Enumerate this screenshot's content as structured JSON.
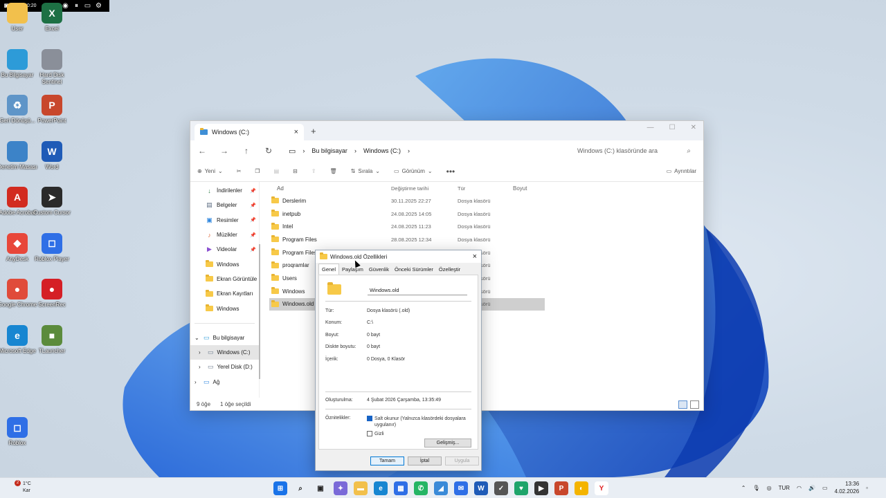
{
  "desktop": {
    "icons": [
      {
        "label": "User",
        "glyph": "",
        "color": "#f2c04c"
      },
      {
        "label": "Excel",
        "glyph": "X",
        "color": "#1d7044"
      },
      {
        "label": "Bu Bilgisayar",
        "glyph": "",
        "color": "#2d9bd8"
      },
      {
        "label": "Hard Disk Sentinel",
        "glyph": "",
        "color": "#8a8f99"
      },
      {
        "label": "Geri Dönüşü...",
        "glyph": "♻",
        "color": "#5f95c8"
      },
      {
        "label": "PowerPoint",
        "glyph": "P",
        "color": "#c8472c"
      },
      {
        "label": "Denetim Masası",
        "glyph": "",
        "color": "#3c83c8"
      },
      {
        "label": "Word",
        "glyph": "W",
        "color": "#1f5bb7"
      },
      {
        "label": "Adobe Acrobat",
        "glyph": "A",
        "color": "#d22b20"
      },
      {
        "label": "Custom Cursor",
        "glyph": "➤",
        "color": "#2a2a2a"
      },
      {
        "label": "AnyDesk",
        "glyph": "◆",
        "color": "#e8473a"
      },
      {
        "label": "Roblox Player",
        "glyph": "◻",
        "color": "#2f6fe6"
      },
      {
        "label": "Google Chrome",
        "glyph": "●",
        "color": "#e04b3a"
      },
      {
        "label": "ScreenRec",
        "glyph": "●",
        "color": "#d51f26"
      },
      {
        "label": "Microsoft Edge",
        "glyph": "e",
        "color": "#1786d1"
      },
      {
        "label": "TLauncher",
        "glyph": "■",
        "color": "#5b8b3c"
      },
      {
        "label": "Roblox",
        "glyph": "◻",
        "color": "#2f6fe6"
      }
    ]
  },
  "recbar": {
    "time": "00:20"
  },
  "explorer": {
    "tab_title": "Windows (C:)",
    "breadcrumb": [
      "Bu bilgisayar",
      "Windows (C:)"
    ],
    "search_placeholder": "Windows (C:) klasöründe ara",
    "cmd": {
      "new": "Yeni",
      "sort": "Sırala",
      "view": "Görünüm",
      "details": "Ayrıntılar"
    },
    "nav": [
      {
        "label": "İndirilenler",
        "pin": true,
        "icon": "download-icon"
      },
      {
        "label": "Belgeler",
        "pin": true,
        "icon": "document-icon"
      },
      {
        "label": "Resimler",
        "pin": true,
        "icon": "image-icon"
      },
      {
        "label": "Müzikler",
        "pin": true,
        "icon": "music-icon"
      },
      {
        "label": "Videolar",
        "pin": true,
        "icon": "video-icon"
      },
      {
        "label": "Windows",
        "pin": false,
        "icon": "folder-icon"
      },
      {
        "label": "Ekran Görüntüle",
        "pin": false,
        "icon": "folder-icon"
      },
      {
        "label": "Ekran Kayıtları",
        "pin": false,
        "icon": "folder-icon"
      },
      {
        "label": "Windows",
        "pin": false,
        "icon": "folder-icon"
      }
    ],
    "nav_tree": [
      {
        "label": "Bu bilgisayar",
        "arrow": "⌄"
      },
      {
        "label": "Windows (C:)",
        "arrow": "›"
      },
      {
        "label": "Yerel Disk (D:)",
        "arrow": "›"
      },
      {
        "label": "Ağ",
        "arrow": "›"
      }
    ],
    "columns": {
      "name": "Ad",
      "date": "Değiştirme tarihi",
      "type": "Tür",
      "size": "Boyut"
    },
    "rows": [
      {
        "name": "Derslerim",
        "date": "30.11.2025 22:27",
        "type": "Dosya klasörü"
      },
      {
        "name": "inetpub",
        "date": "24.08.2025 14:05",
        "type": "Dosya klasörü"
      },
      {
        "name": "Intel",
        "date": "24.08.2025 11:23",
        "type": "Dosya klasörü"
      },
      {
        "name": "Program Files",
        "date": "28.08.2025 12:34",
        "type": "Dosya klasörü"
      },
      {
        "name": "Program Files",
        "date": "",
        "type": "Dosya klasörü"
      },
      {
        "name": "proqramlar",
        "date": "",
        "type": "Dosya klasörü"
      },
      {
        "name": "Users",
        "date": "",
        "type": "Dosya klasörü"
      },
      {
        "name": "Windows",
        "date": "",
        "type": "Dosya klasörü"
      },
      {
        "name": "Windows.old",
        "date": "",
        "type": "Dosya klasörü"
      }
    ],
    "status": {
      "count": "9 öğe",
      "selected": "1 öğe seçildi"
    }
  },
  "dialog": {
    "title": "Windows.old Özellikleri",
    "tabs": [
      "Genel",
      "Paylaşım",
      "Güvenlik",
      "Önceki Sürümler",
      "Özelleştir"
    ],
    "name": "Windows.old",
    "props": [
      {
        "k": "Tür:",
        "v": "Dosya klasörü (.old)"
      },
      {
        "k": "Konum:",
        "v": "C:\\"
      },
      {
        "k": "Boyut:",
        "v": "0 bayt"
      },
      {
        "k": "Diskte boyutu:",
        "v": "0 bayt"
      },
      {
        "k": "İçerik:",
        "v": "0 Dosya, 0 Klasör"
      }
    ],
    "created_label": "Oluşturulma:",
    "created_value": "4 Şubat 2026 Çarşamba, 13:35:49",
    "attrs_label": "Öznitelikler:",
    "readonly": "Salt okunur (Yalnızca klasördeki dosyalara uygulanır)",
    "hidden": "Gizli",
    "advanced": "Gelişmiş...",
    "ok": "Tamam",
    "cancel": "İptal",
    "apply": "Uygula"
  },
  "taskbar": {
    "weather_temp": "1°C",
    "weather_desc": "Kar",
    "badge": "2",
    "lang": "TUR",
    "time": "13:36",
    "date": "4.02.2026",
    "apps": [
      {
        "name": "start",
        "color": "#1a73e8",
        "glyph": "⊞"
      },
      {
        "name": "search",
        "color": "#e9eef4",
        "glyph": "⌕"
      },
      {
        "name": "taskview",
        "color": "#e9eef4",
        "glyph": "▣"
      },
      {
        "name": "copilot",
        "color": "#7a6ad8",
        "glyph": "✦"
      },
      {
        "name": "explorer",
        "color": "#f2c04c",
        "glyph": "▬"
      },
      {
        "name": "edge",
        "color": "#1786d1",
        "glyph": "e"
      },
      {
        "name": "store",
        "color": "#2f6fe6",
        "glyph": "▦"
      },
      {
        "name": "whatsapp",
        "color": "#25b565",
        "glyph": "✆"
      },
      {
        "name": "photos",
        "color": "#3a8ad8",
        "glyph": "◢"
      },
      {
        "name": "mail",
        "color": "#2f6fe6",
        "glyph": "✉"
      },
      {
        "name": "word",
        "color": "#1f5bb7",
        "glyph": "W"
      },
      {
        "name": "app",
        "color": "#555",
        "glyph": "✓"
      },
      {
        "name": "app2",
        "color": "#1ea46a",
        "glyph": "♥"
      },
      {
        "name": "media",
        "color": "#333",
        "glyph": "▶"
      },
      {
        "name": "powerpoint",
        "color": "#c8472c",
        "glyph": "P"
      },
      {
        "name": "app3",
        "color": "#f4b400",
        "glyph": "◐"
      },
      {
        "name": "yandex",
        "color": "#fff",
        "glyph": "Y"
      }
    ]
  }
}
